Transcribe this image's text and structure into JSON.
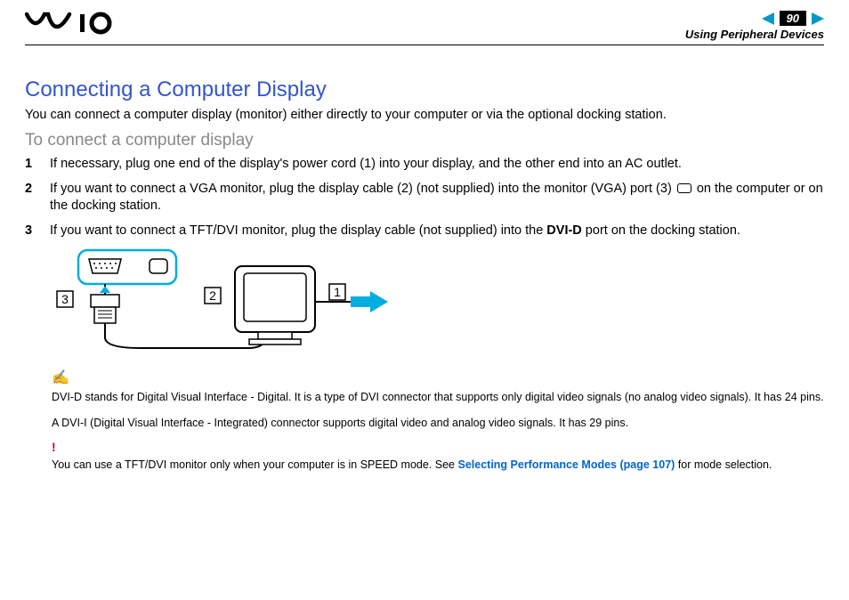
{
  "header": {
    "page_number": "90",
    "section": "Using Peripheral Devices"
  },
  "title": "Connecting a Computer Display",
  "lead": "You can connect a computer display (monitor) either directly to your computer or via the optional docking station.",
  "subtitle": "To connect a computer display",
  "steps": {
    "s1": "If necessary, plug one end of the display's power cord (1) into your display, and the other end into an AC outlet.",
    "s2a": "If you want to connect a VGA monitor, plug the display cable (2) (not supplied) into the monitor (VGA) port (3) ",
    "s2b": " on the computer or on the docking station.",
    "s3a": "If you want to connect a TFT/DVI monitor, plug the display cable (not supplied) into the ",
    "s3b": "DVI-D",
    "s3c": " port on the docking station."
  },
  "diagram_labels": {
    "l1": "1",
    "l2": "2",
    "l3": "3"
  },
  "notes": {
    "n1": "DVI-D stands for Digital Visual Interface - Digital. It is a type of DVI connector that supports only digital video signals (no analog video signals). It has 24 pins.",
    "n2": "A DVI-I (Digital Visual Interface - Integrated) connector supports digital video and analog video signals. It has 29 pins."
  },
  "warning": {
    "pre": "You can use a TFT/DVI monitor only when your computer is in SPEED mode. See ",
    "link": "Selecting Performance Modes (page 107)",
    "post": " for mode selection."
  }
}
